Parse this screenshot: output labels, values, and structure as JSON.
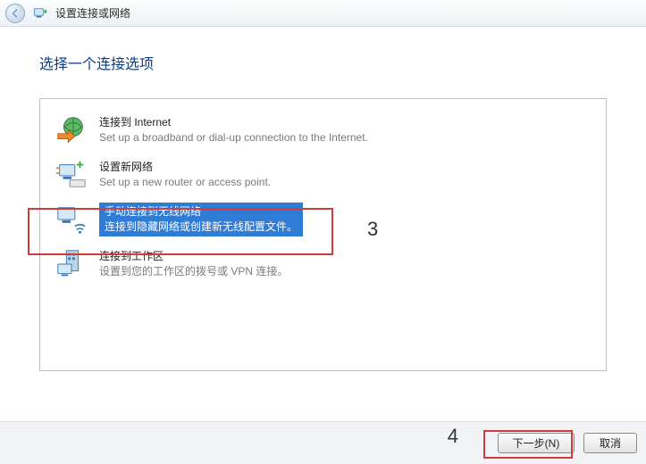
{
  "window": {
    "title": "设置连接或网络"
  },
  "heading": "选择一个连接选项",
  "options": [
    {
      "title": "连接到 Internet",
      "desc": "Set up a broadband or dial-up connection to the Internet."
    },
    {
      "title": "设置新网络",
      "desc": "Set up a new router or access point."
    },
    {
      "title": "手动连接到无线网络",
      "desc": "连接到隐藏网络或创建新无线配置文件。"
    },
    {
      "title": "连接到工作区",
      "desc": "设置到您的工作区的拨号或 VPN 连接。"
    }
  ],
  "annotations": {
    "label3": "3",
    "label4": "4"
  },
  "buttons": {
    "next": "下一步(N)",
    "cancel": "取消"
  }
}
